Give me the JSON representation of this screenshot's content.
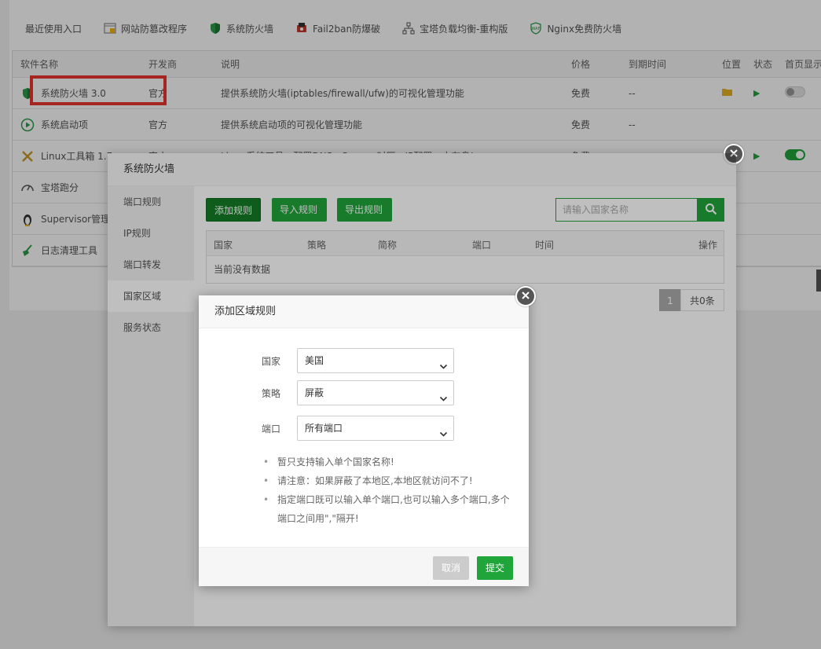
{
  "recent": {
    "label": "最近使用入口",
    "items": [
      {
        "label": "网站防篡改程序",
        "icon": "tamper-icon"
      },
      {
        "label": "系统防火墙",
        "icon": "shield-icon"
      },
      {
        "label": "Fail2ban防爆破",
        "icon": "fail2ban-icon"
      },
      {
        "label": "宝塔负载均衡-重构版",
        "icon": "network-icon"
      },
      {
        "label": "Nginx免费防火墙",
        "icon": "waf-icon"
      }
    ]
  },
  "table": {
    "headers": {
      "name": "软件名称",
      "developer": "开发商",
      "desc": "说明",
      "price": "价格",
      "expire": "到期时间",
      "position": "位置",
      "status": "状态",
      "home": "首页显示"
    },
    "rows": [
      {
        "name": "系统防火墙 3.0",
        "developer": "官方",
        "desc": "提供系统防火墙(iptables/firewall/ufw)的可视化管理功能",
        "price": "免费",
        "expire": "--"
      },
      {
        "name": "系统启动项",
        "developer": "官方",
        "desc": "提供系统启动项的可视化管理功能",
        "price": "免费",
        "expire": "--"
      },
      {
        "name": "Linux工具箱 1.7",
        "developer": "官方",
        "desc": "Linux系统工具，配置DNS、Swap、时区、IP配置、内存盘!",
        "price": "免费",
        "expire": ""
      },
      {
        "name": "宝塔跑分",
        "developer": "",
        "desc": "",
        "price": "",
        "expire": ""
      },
      {
        "name": "Supervisor管理器",
        "developer": "",
        "desc": "",
        "price": "",
        "expire": ""
      },
      {
        "name": "日志清理工具",
        "developer": "",
        "desc": "",
        "price": "",
        "expire": ""
      }
    ]
  },
  "firewall": {
    "title": "系统防火墙",
    "menu": [
      "端口规则",
      "IP规则",
      "端口转发",
      "国家区域",
      "服务状态"
    ],
    "buttons": {
      "add": "添加规则",
      "import": "导入规则",
      "export": "导出规则"
    },
    "search_placeholder": "请输入国家名称",
    "columns": {
      "country": "国家",
      "policy": "策略",
      "abbr": "简称",
      "port": "端口",
      "time": "时间",
      "action": "操作"
    },
    "empty": "当前没有数据",
    "page": "1",
    "total": "共0条"
  },
  "dialog": {
    "title": "添加区域规则",
    "country_label": "国家",
    "country_value": "美国",
    "policy_label": "策略",
    "policy_value": "屏蔽",
    "port_label": "端口",
    "port_value": "所有端口",
    "tips": [
      "暂只支持输入单个国家名称!",
      "请注意：如果屏蔽了本地区,本地区就访问不了!",
      "指定端口既可以输入单个端口,也可以输入多个端口,多个端口之间用\",\"隔开!"
    ],
    "cancel": "取消",
    "submit": "提交"
  },
  "colors": {
    "accent": "#20a53a",
    "highlight": "#f0352f"
  }
}
